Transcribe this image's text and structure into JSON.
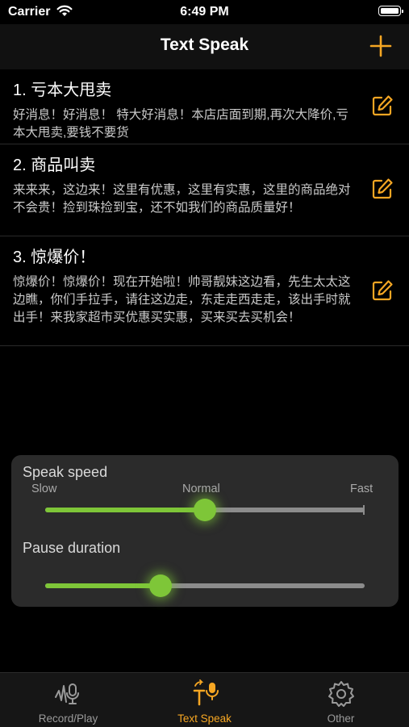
{
  "status": {
    "carrier": "Carrier",
    "time": "6:49 PM"
  },
  "nav": {
    "title": "Text Speak"
  },
  "colors": {
    "accent": "#f5a623",
    "slider_active": "#7ec638",
    "slider_track": "#8c8c8c"
  },
  "items": [
    {
      "title": "1. 亏本大甩卖",
      "text": "好消息！好消息！ 特大好消息！本店店面到期,再次大降价,亏本大甩卖,要钱不要货"
    },
    {
      "title": "2. 商品叫卖",
      "text": "来来来，这边来！这里有优惠，这里有实惠，这里的商品绝对不会贵！捡到珠捡到宝，还不如我们的商品质量好！"
    },
    {
      "title": "3. 惊爆价！",
      "text": "惊爆价！惊爆价！现在开始啦！帅哥靓妹这边看，先生太太这边瞧，你们手拉手，请往这边走，东走走西走走，该出手时就出手！来我家超市买优惠买实惠，买来买去买机会！"
    }
  ],
  "settings": {
    "speed_label": "Speak speed",
    "speed_ticks": {
      "slow": "Slow",
      "normal": "Normal",
      "fast": "Fast"
    },
    "speed_value": 0.5,
    "pause_label": "Pause duration",
    "pause_value": 0.36
  },
  "tabs": [
    {
      "label": "Record/Play",
      "icon": "waveform-mic-icon",
      "active": false
    },
    {
      "label": "Text Speak",
      "icon": "text-to-speech-icon",
      "active": true
    },
    {
      "label": "Other",
      "icon": "gear-icon",
      "active": false
    }
  ]
}
